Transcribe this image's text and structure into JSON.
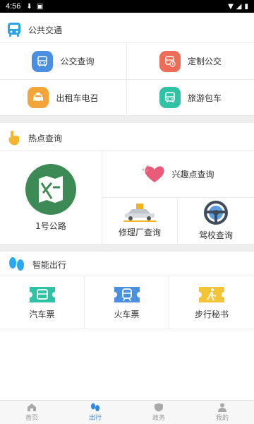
{
  "status_bar": {
    "time": "4:56"
  },
  "sections": {
    "public_transport": {
      "title": "公共交通",
      "items": [
        {
          "label": "公交查询",
          "icon": "bus-icon",
          "color": "#4a8fe0"
        },
        {
          "label": "定制公交",
          "icon": "custom-bus-icon",
          "color": "#ef6d56"
        },
        {
          "label": "出租车电召",
          "icon": "taxi-icon",
          "color": "#f3a537"
        },
        {
          "label": "旅游包车",
          "icon": "tour-bus-icon",
          "color": "#2fc2a5"
        }
      ]
    },
    "hot_query": {
      "title": "热点查询",
      "items": [
        {
          "label": "1号公路",
          "icon": "map-icon",
          "color": "#3d8a55"
        },
        {
          "label": "兴趣点查询",
          "icon": "heart-icon",
          "color": "#ea5b79"
        },
        {
          "label": "修理厂查询",
          "icon": "car-lift-icon"
        },
        {
          "label": "驾校查询",
          "icon": "steering-wheel-icon"
        }
      ]
    },
    "smart_travel": {
      "title": "智能出行",
      "items": [
        {
          "label": "汽车票",
          "icon": "bus-ticket-icon",
          "color": "#2fc2a5"
        },
        {
          "label": "火车票",
          "icon": "train-ticket-icon",
          "color": "#4a8fe0"
        },
        {
          "label": "步行秘书",
          "icon": "walk-ticket-icon",
          "color": "#f3c437"
        }
      ]
    }
  },
  "bottom_nav": [
    {
      "label": "首页",
      "icon": "home-icon",
      "active": false
    },
    {
      "label": "出行",
      "icon": "footprints-icon",
      "active": true
    },
    {
      "label": "政务",
      "icon": "shield-icon",
      "active": false
    },
    {
      "label": "我的",
      "icon": "person-icon",
      "active": false
    }
  ],
  "colors": {
    "accent": "#2f88e8",
    "divider": "#eeeeee"
  }
}
